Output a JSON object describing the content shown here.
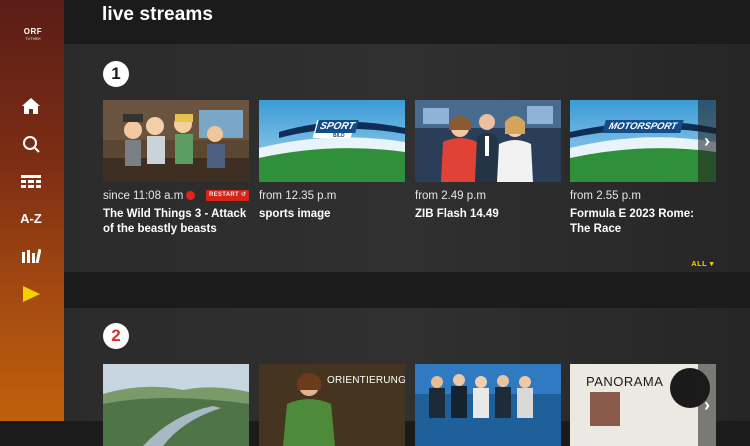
{
  "sidebar": {
    "logo": {
      "brand": "ORF",
      "sub": "TVTHEK"
    },
    "items": [
      {
        "icon": "home-icon",
        "label": ""
      },
      {
        "icon": "search-icon",
        "label": ""
      },
      {
        "icon": "schedule-icon",
        "label": ""
      },
      {
        "icon": "az-icon",
        "label": "A-Z"
      },
      {
        "icon": "archive-icon",
        "label": ""
      },
      {
        "icon": "live-play-icon",
        "label": ""
      }
    ],
    "active_color": "#f4d000"
  },
  "page": {
    "title": "live streams",
    "all_label": "ALL"
  },
  "rows": [
    {
      "number": "1",
      "cards": [
        {
          "time": "since 11:08 a.m",
          "live": true,
          "restart": "RESTART",
          "title": "The Wild Things 3 - Attack of the beastly beasts",
          "thumb": "cartoon"
        },
        {
          "time": "from 12.35 p.m",
          "title": "sports image",
          "thumb": "sport",
          "banner": "SPORT",
          "banner_sub": "BILD"
        },
        {
          "time": "from 2.49 p.m",
          "title": "ZIB Flash 14.49",
          "thumb": "news"
        },
        {
          "time": "from 2.55 p.m",
          "title": "Formula E 2023 Rome: The Race",
          "thumb": "motorsport",
          "banner": "MOTORSPORT"
        }
      ]
    },
    {
      "number": "2",
      "cards": [
        {
          "thumb": "landscape"
        },
        {
          "thumb": "orientierung",
          "banner": "ORIENTIERUNG"
        },
        {
          "thumb": "studio"
        },
        {
          "thumb": "panorama",
          "banner": "PANORAMA"
        }
      ]
    }
  ]
}
